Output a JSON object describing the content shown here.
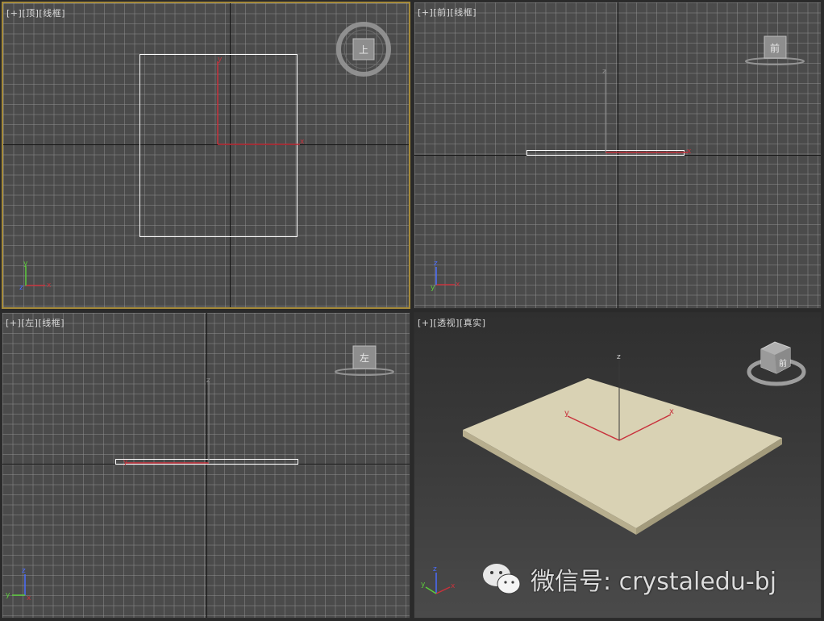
{
  "viewports": {
    "top": {
      "plus": "[+]",
      "view": "[顶]",
      "mode": "[线框]",
      "cube_label": "上"
    },
    "front": {
      "plus": "[+]",
      "view": "[前]",
      "mode": "[线框]",
      "cube_label": "前"
    },
    "left": {
      "plus": "[+]",
      "view": "[左]",
      "mode": "[线框]",
      "cube_label": "左"
    },
    "perspective": {
      "plus": "[+]",
      "view": "[透视]",
      "mode": "[真实]",
      "cube_label": "前"
    }
  },
  "axis_labels": {
    "x": "x",
    "y": "y",
    "z": "z"
  },
  "watermark": {
    "text": "微信号: crystaledu-bj"
  },
  "colors": {
    "active_border": "#a58a3a",
    "grid": "#4b4b4b",
    "plane": "#d9d2b4",
    "x_axis": "#c8323c",
    "y_axis": "#5ccc3c",
    "z_axis": "#4a6cff"
  }
}
